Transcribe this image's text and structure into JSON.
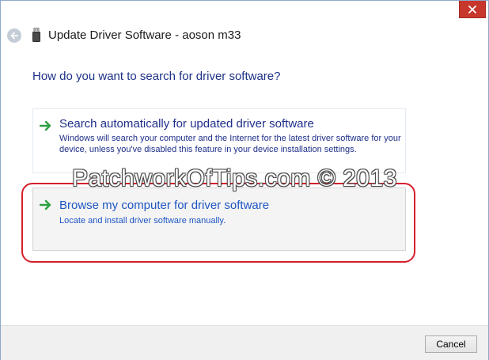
{
  "window": {
    "title": "Update Driver Software - aoson m33"
  },
  "main": {
    "heading": "How do you want to search for driver software?",
    "options": [
      {
        "title": "Search automatically for updated driver software",
        "description": "Windows will search your computer and the Internet for the latest driver software for your device, unless you've disabled this feature in your device installation settings."
      },
      {
        "title": "Browse my computer for driver software",
        "description": "Locate and install driver software manually."
      }
    ]
  },
  "watermark": "PatchworkOfTips.com © 2013",
  "footer": {
    "cancel_label": "Cancel"
  },
  "colors": {
    "heading": "#1e3287",
    "link": "#1f56c4",
    "close": "#c7372c",
    "highlight": "#d61f2c",
    "arrow": "#2ea043"
  }
}
